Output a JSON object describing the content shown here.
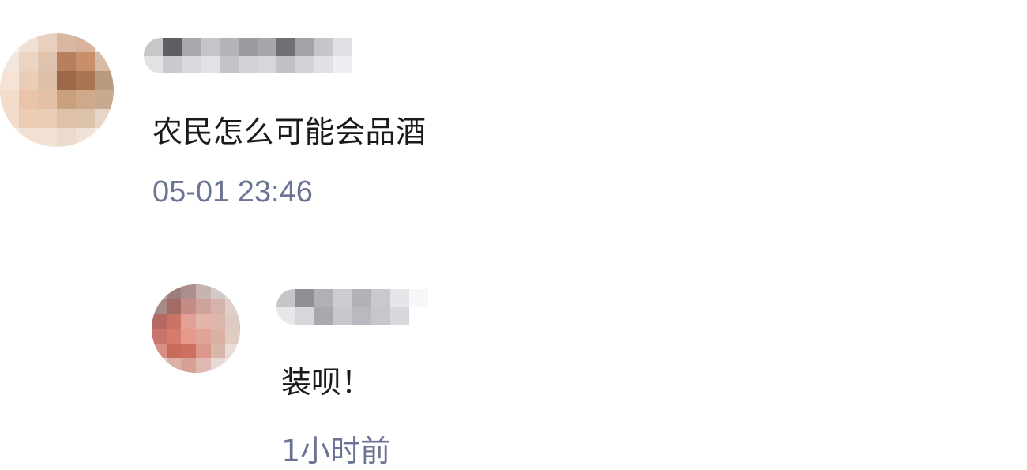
{
  "comments": [
    {
      "text": "农民怎么可能会品酒",
      "time": "05-01 23:46"
    },
    {
      "text": "装呗！",
      "time": "1小时前"
    }
  ],
  "colors": {
    "text": "#1a1a1a",
    "timestamp": "#6b7394",
    "background": "#ffffff"
  },
  "icons": {
    "avatar_main": "pixelated-avatar-icon",
    "avatar_reply": "pixelated-avatar-icon"
  }
}
